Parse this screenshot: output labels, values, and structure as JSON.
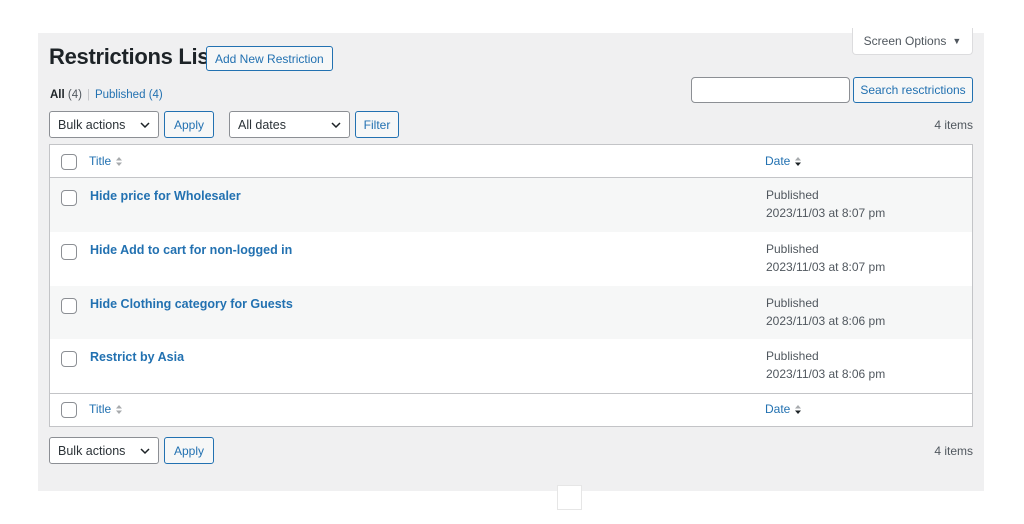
{
  "header": {
    "title": "Restrictions List",
    "add_new_label": "Add New Restriction",
    "screen_options_label": "Screen Options"
  },
  "views": [
    {
      "label": "All",
      "count": "(4)"
    },
    {
      "label": "Published",
      "count": "(4)"
    }
  ],
  "search": {
    "value": "",
    "placeholder": "",
    "button_label": "Search resctrictions"
  },
  "top_nav": {
    "bulk_actions": "Bulk actions",
    "apply_label": "Apply",
    "dates_filter": "All dates",
    "filter_label": "Filter",
    "items_count": "4 items"
  },
  "table": {
    "columns": [
      "Title",
      "Date"
    ],
    "rows": [
      {
        "title": "Hide price for Wholesaler",
        "status": "Published",
        "date": "2023/11/03 at 8:07 pm"
      },
      {
        "title": "Hide Add to cart for non-logged in",
        "status": "Published",
        "date": "2023/11/03 at 8:07 pm"
      },
      {
        "title": "Hide Clothing category for Guests",
        "status": "Published",
        "date": "2023/11/03 at 8:06 pm"
      },
      {
        "title": "Restrict by Asia",
        "status": "Published",
        "date": "2023/11/03 at 8:06 pm"
      }
    ]
  },
  "bottom_nav": {
    "bulk_actions": "Bulk actions",
    "apply_label": "Apply",
    "items_count": "4 items"
  },
  "colors": {
    "accent": "#2271b1",
    "background": "#f0f0f1",
    "border": "#c3c4c7",
    "text": "#1d2327"
  }
}
